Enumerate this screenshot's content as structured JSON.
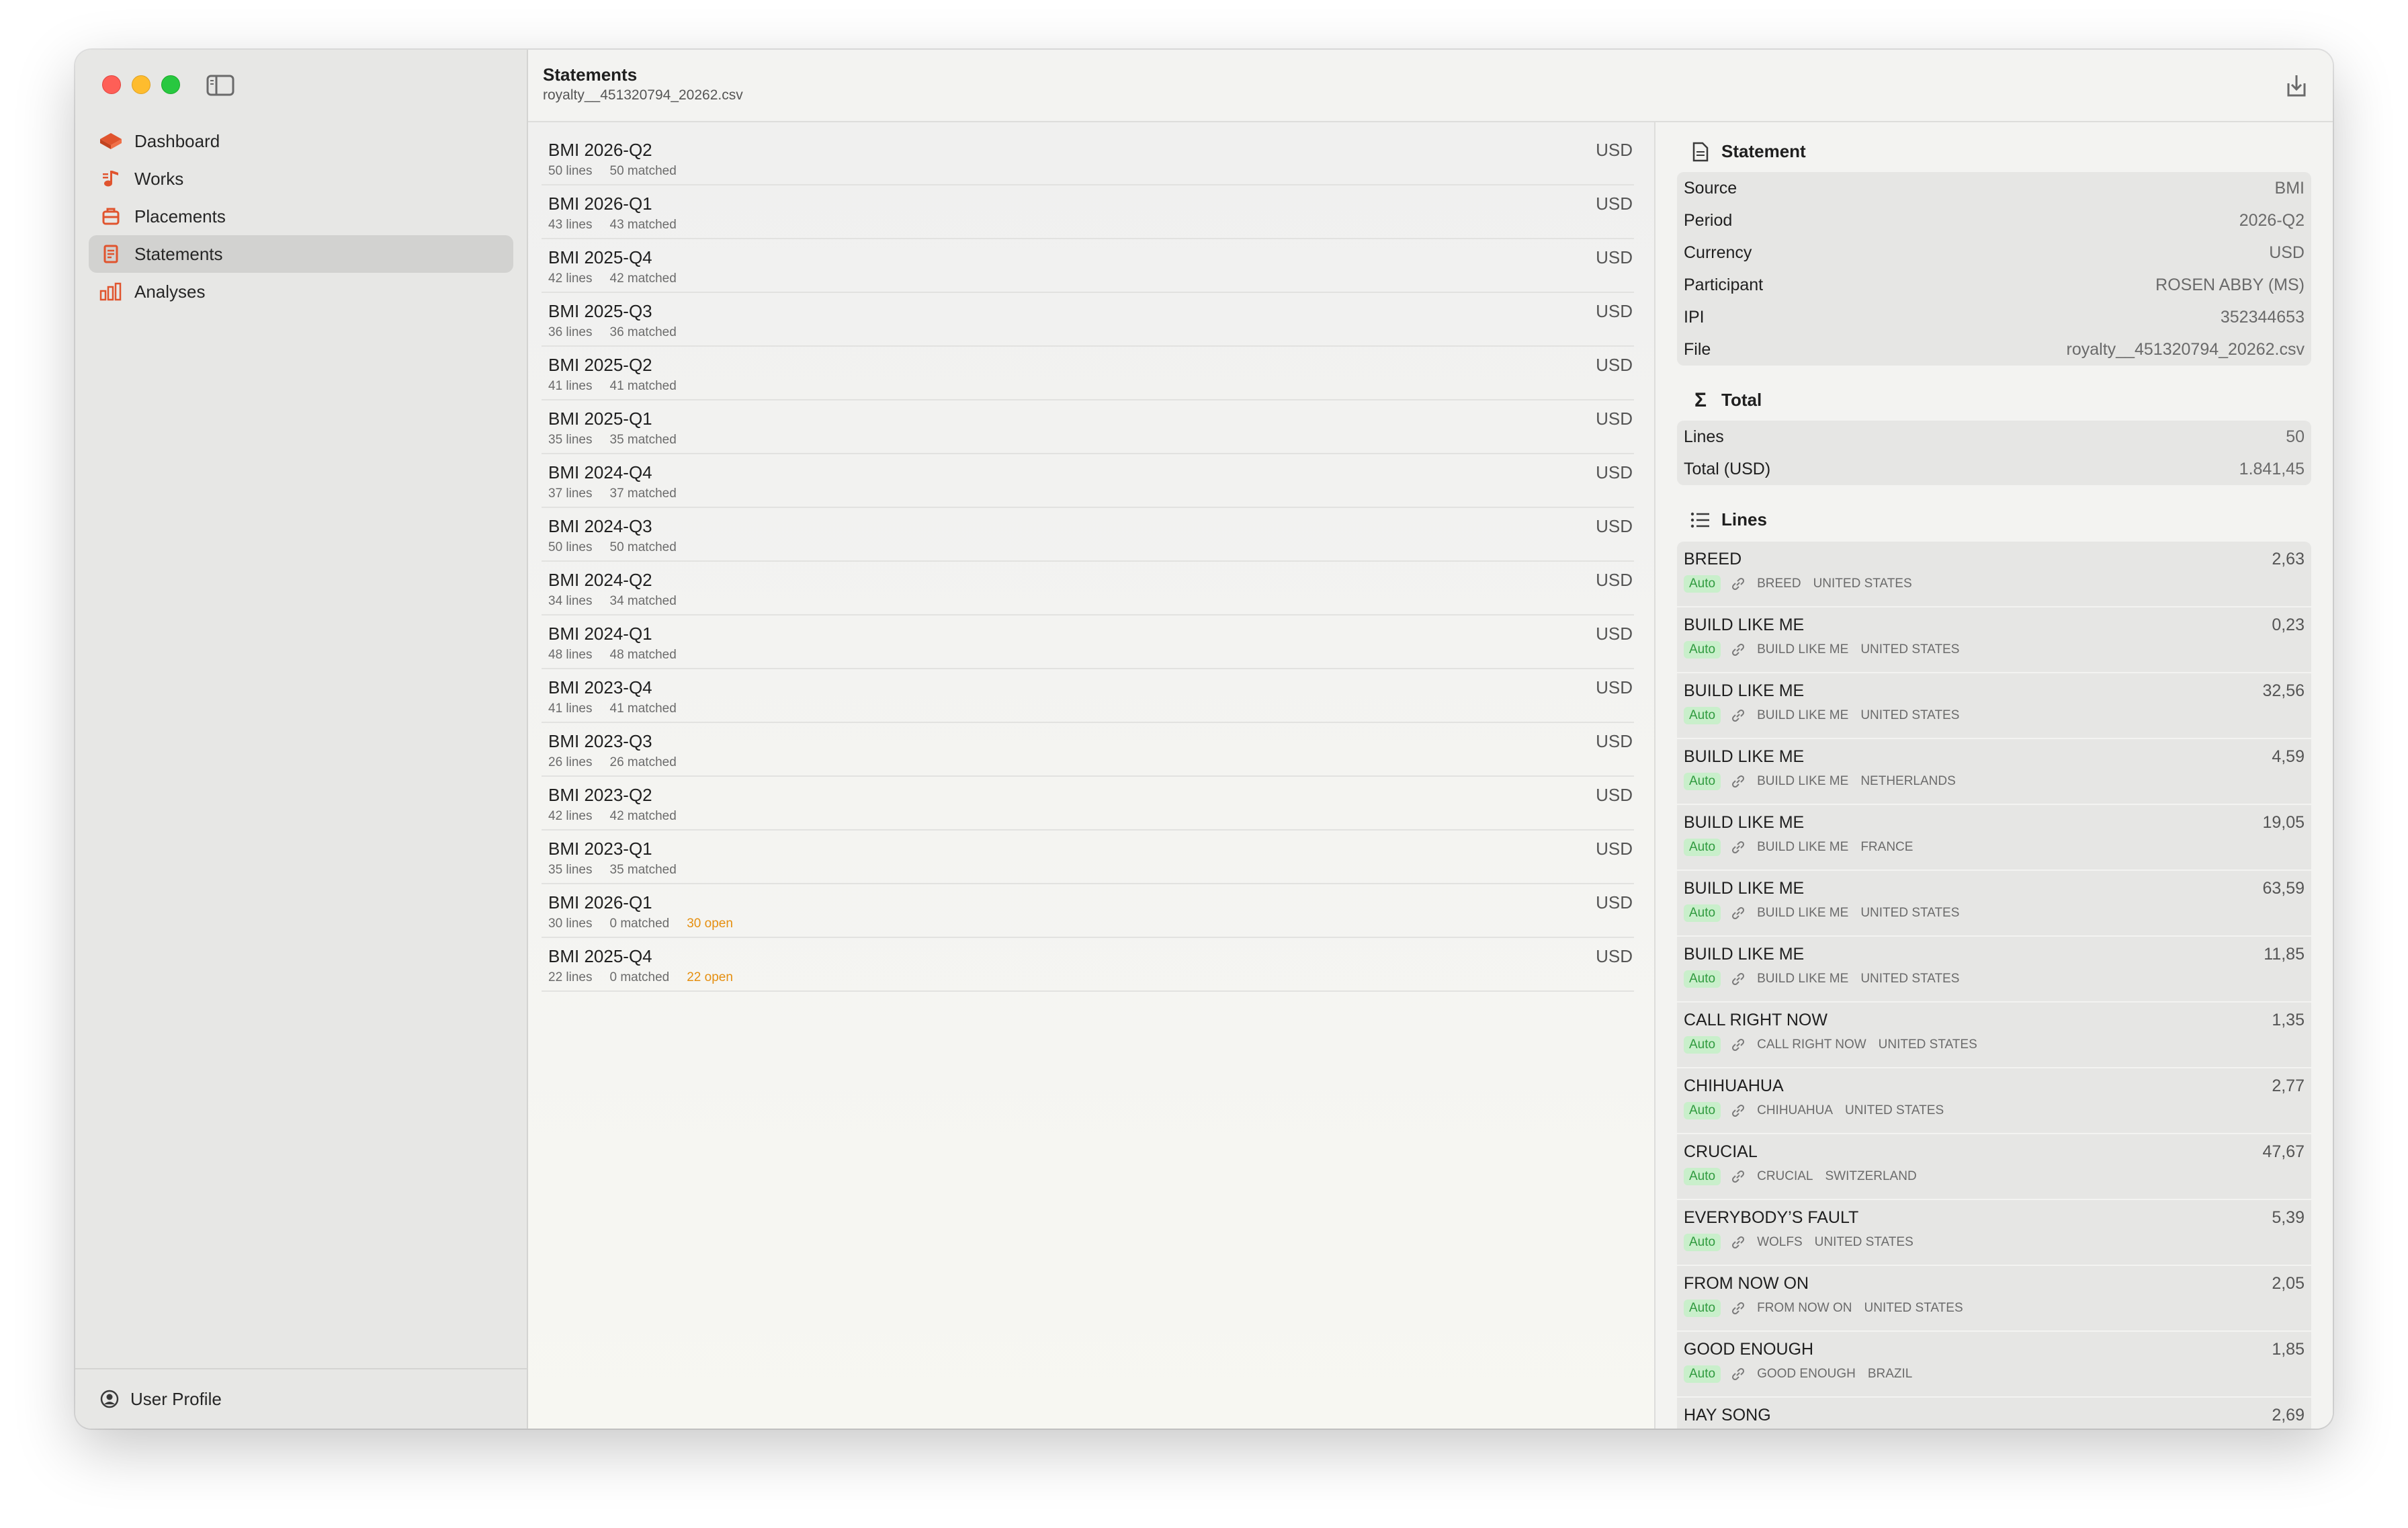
{
  "sidebar": {
    "items": [
      {
        "label": "Dashboard",
        "icon": "dashboard-icon",
        "selected": false
      },
      {
        "label": "Works",
        "icon": "music-note-icon",
        "selected": false
      },
      {
        "label": "Placements",
        "icon": "placements-icon",
        "selected": false
      },
      {
        "label": "Statements",
        "icon": "statement-doc-icon",
        "selected": true
      },
      {
        "label": "Analyses",
        "icon": "bar-chart-icon",
        "selected": false
      }
    ],
    "footer": {
      "label": "User Profile",
      "icon": "user-circle-icon"
    }
  },
  "header": {
    "title": "Statements",
    "subtitle": "royalty__451320794_20262.csv"
  },
  "statements": [
    {
      "name": "BMI 2026-Q2",
      "lines": "50 lines",
      "matched": "50 matched",
      "open": "",
      "currency": "USD"
    },
    {
      "name": "BMI 2026-Q1",
      "lines": "43 lines",
      "matched": "43 matched",
      "open": "",
      "currency": "USD"
    },
    {
      "name": "BMI 2025-Q4",
      "lines": "42 lines",
      "matched": "42 matched",
      "open": "",
      "currency": "USD"
    },
    {
      "name": "BMI 2025-Q3",
      "lines": "36 lines",
      "matched": "36 matched",
      "open": "",
      "currency": "USD"
    },
    {
      "name": "BMI 2025-Q2",
      "lines": "41 lines",
      "matched": "41 matched",
      "open": "",
      "currency": "USD"
    },
    {
      "name": "BMI 2025-Q1",
      "lines": "35 lines",
      "matched": "35 matched",
      "open": "",
      "currency": "USD"
    },
    {
      "name": "BMI 2024-Q4",
      "lines": "37 lines",
      "matched": "37 matched",
      "open": "",
      "currency": "USD"
    },
    {
      "name": "BMI 2024-Q3",
      "lines": "50 lines",
      "matched": "50 matched",
      "open": "",
      "currency": "USD"
    },
    {
      "name": "BMI 2024-Q2",
      "lines": "34 lines",
      "matched": "34 matched",
      "open": "",
      "currency": "USD"
    },
    {
      "name": "BMI 2024-Q1",
      "lines": "48 lines",
      "matched": "48 matched",
      "open": "",
      "currency": "USD"
    },
    {
      "name": "BMI 2023-Q4",
      "lines": "41 lines",
      "matched": "41 matched",
      "open": "",
      "currency": "USD"
    },
    {
      "name": "BMI 2023-Q3",
      "lines": "26 lines",
      "matched": "26 matched",
      "open": "",
      "currency": "USD"
    },
    {
      "name": "BMI 2023-Q2",
      "lines": "42 lines",
      "matched": "42 matched",
      "open": "",
      "currency": "USD"
    },
    {
      "name": "BMI 2023-Q1",
      "lines": "35 lines",
      "matched": "35 matched",
      "open": "",
      "currency": "USD"
    },
    {
      "name": "BMI 2026-Q1",
      "lines": "30 lines",
      "matched": "0 matched",
      "open": "30 open",
      "currency": "USD"
    },
    {
      "name": "BMI 2025-Q4",
      "lines": "22 lines",
      "matched": "0 matched",
      "open": "22 open",
      "currency": "USD"
    }
  ],
  "detail": {
    "statement": {
      "heading": "Statement",
      "rows": [
        {
          "key": "Source",
          "value": "BMI"
        },
        {
          "key": "Period",
          "value": "2026-Q2"
        },
        {
          "key": "Currency",
          "value": "USD"
        },
        {
          "key": "Participant",
          "value": "ROSEN ABBY (MS)"
        },
        {
          "key": "IPI",
          "value": "352344653"
        },
        {
          "key": "File",
          "value": "royalty__451320794_20262.csv"
        }
      ]
    },
    "total": {
      "heading": "Total",
      "rows": [
        {
          "key": "Lines",
          "value": "50"
        },
        {
          "key": "Total (USD)",
          "value": "1.841,45"
        }
      ]
    },
    "lines": {
      "heading": "Lines",
      "items": [
        {
          "title": "BREED",
          "amount": "2,63",
          "badge": "Auto",
          "work": "BREED",
          "territory": "UNITED STATES"
        },
        {
          "title": "BUILD LIKE ME",
          "amount": "0,23",
          "badge": "Auto",
          "work": "BUILD LIKE ME",
          "territory": "UNITED STATES"
        },
        {
          "title": "BUILD LIKE ME",
          "amount": "32,56",
          "badge": "Auto",
          "work": "BUILD LIKE ME",
          "territory": "UNITED STATES"
        },
        {
          "title": "BUILD LIKE ME",
          "amount": "4,59",
          "badge": "Auto",
          "work": "BUILD LIKE ME",
          "territory": "NETHERLANDS"
        },
        {
          "title": "BUILD LIKE ME",
          "amount": "19,05",
          "badge": "Auto",
          "work": "BUILD LIKE ME",
          "territory": "FRANCE"
        },
        {
          "title": "BUILD LIKE ME",
          "amount": "63,59",
          "badge": "Auto",
          "work": "BUILD LIKE ME",
          "territory": "UNITED STATES"
        },
        {
          "title": "BUILD LIKE ME",
          "amount": "11,85",
          "badge": "Auto",
          "work": "BUILD LIKE ME",
          "territory": "UNITED STATES"
        },
        {
          "title": "CALL RIGHT NOW",
          "amount": "1,35",
          "badge": "Auto",
          "work": "CALL RIGHT NOW",
          "territory": "UNITED STATES"
        },
        {
          "title": "CHIHUAHUA",
          "amount": "2,77",
          "badge": "Auto",
          "work": "CHIHUAHUA",
          "territory": "UNITED STATES"
        },
        {
          "title": "CRUCIAL",
          "amount": "47,67",
          "badge": "Auto",
          "work": "CRUCIAL",
          "territory": "SWITZERLAND"
        },
        {
          "title": "EVERYBODY’S FAULT",
          "amount": "5,39",
          "badge": "Auto",
          "work": "WOLFS",
          "territory": "UNITED STATES"
        },
        {
          "title": "FROM NOW ON",
          "amount": "2,05",
          "badge": "Auto",
          "work": "FROM NOW ON",
          "territory": "UNITED STATES"
        },
        {
          "title": "GOOD ENOUGH",
          "amount": "1,85",
          "badge": "Auto",
          "work": "GOOD ENOUGH",
          "territory": "BRAZIL"
        },
        {
          "title": "HAY SONG",
          "amount": "2,69",
          "badge": "",
          "work": "",
          "territory": ""
        }
      ]
    }
  },
  "colors": {
    "accent": "#e0542e",
    "open": "#e58f10",
    "badge_bg": "#c9efcb",
    "badge_text": "#2f9a3e"
  }
}
